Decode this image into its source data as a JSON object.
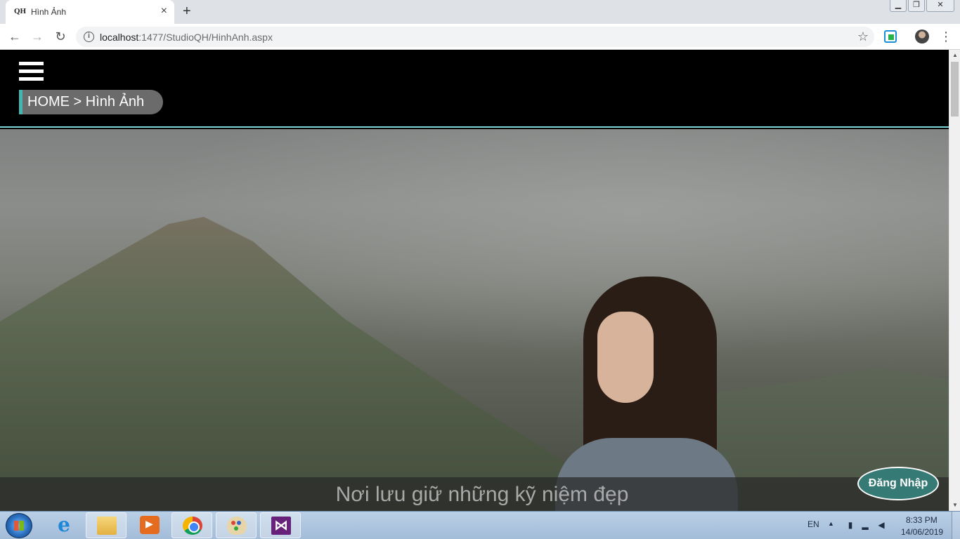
{
  "browser": {
    "tab_title": "Hình Ảnh",
    "tab_favicon": "QH",
    "tab_close": "×",
    "new_tab": "+",
    "url_host": "localhost",
    "url_rest": ":1477/StudioQH/HinhAnh.aspx",
    "window_buttons": {
      "minimize": "▁",
      "restore": "❐",
      "close": "✕"
    },
    "nav": {
      "back": "←",
      "forward": "→",
      "reload": "↻"
    },
    "bookmark": "☆",
    "menu": "⋮"
  },
  "site": {
    "breadcrumb": "HOME > Hình Ảnh",
    "caption": "Nơi lưu giữ những kỹ niệm đẹp",
    "login_label": "Đăng Nhập",
    "accent_color": "#45b5b0",
    "login_color": "#357a75"
  },
  "scrollbar": {
    "up": "▲",
    "down": "▼"
  },
  "taskbar": {
    "apps": [
      {
        "name": "internet-explorer",
        "glyph": "e"
      },
      {
        "name": "file-explorer"
      },
      {
        "name": "media-player"
      },
      {
        "name": "chrome"
      },
      {
        "name": "paint"
      },
      {
        "name": "visual-studio",
        "glyph": "⋈"
      }
    ],
    "language": "EN",
    "tray_arrow": "▲",
    "time": "8:33 PM",
    "date": "14/06/2019"
  }
}
